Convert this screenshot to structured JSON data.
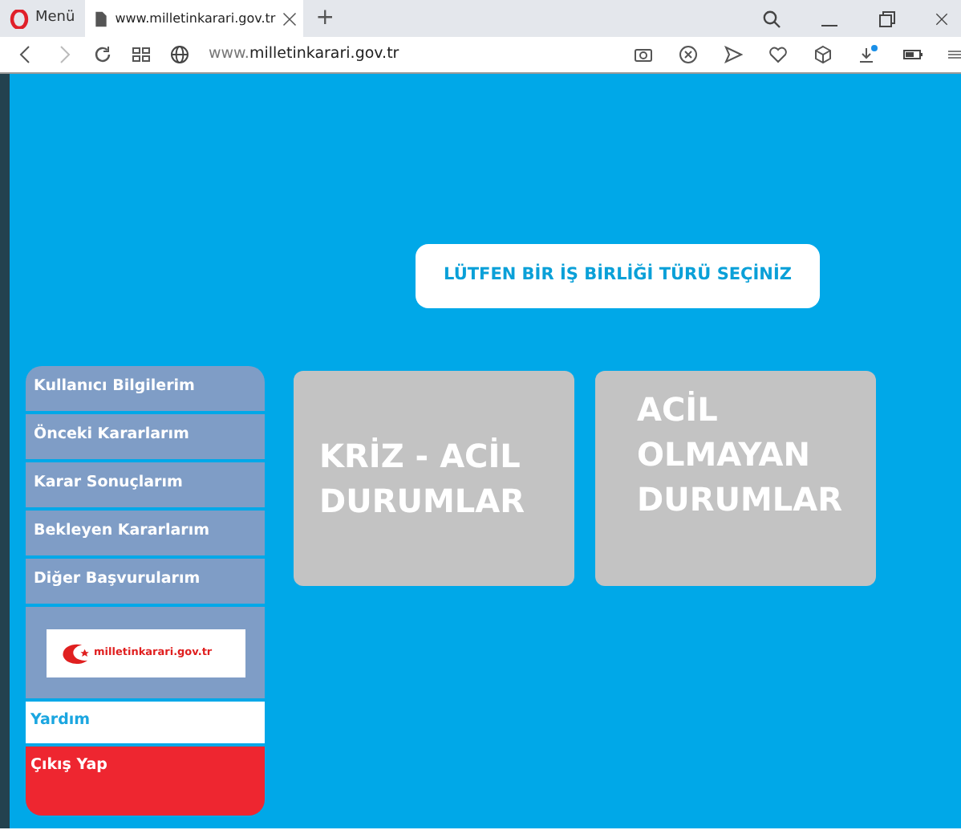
{
  "browser": {
    "menu_label": "Menü",
    "tabs": [
      {
        "title": "www.milletinkarari.gov.tr",
        "selected": true
      }
    ],
    "new_tab": "+",
    "url_prefix": "www.",
    "url_domain": "milletinkarari.gov.tr"
  },
  "page": {
    "heading": "LÜTFEN BİR İŞ BİRLİĞİ TÜRÜ SEÇİNİZ",
    "sidebar": [
      {
        "kind": "link",
        "label": "Kullanıcı Bilgilerim"
      },
      {
        "kind": "link",
        "label": "Önceki Kararlarım"
      },
      {
        "kind": "link",
        "label": "Karar Sonuçlarım"
      },
      {
        "kind": "link",
        "label": "Bekleyen Kararlarım"
      },
      {
        "kind": "link",
        "label": "Diğer Başvurularım"
      },
      {
        "kind": "logo",
        "label": "milletinkarari.gov.tr"
      },
      {
        "kind": "help",
        "label": "Yardım"
      },
      {
        "kind": "logout",
        "label": "Çıkış Yap"
      }
    ],
    "options": [
      {
        "label": "KRİZ - ACİL DURUMLAR"
      },
      {
        "label": "ACİL OLMAYAN DURUMLAR"
      }
    ]
  }
}
